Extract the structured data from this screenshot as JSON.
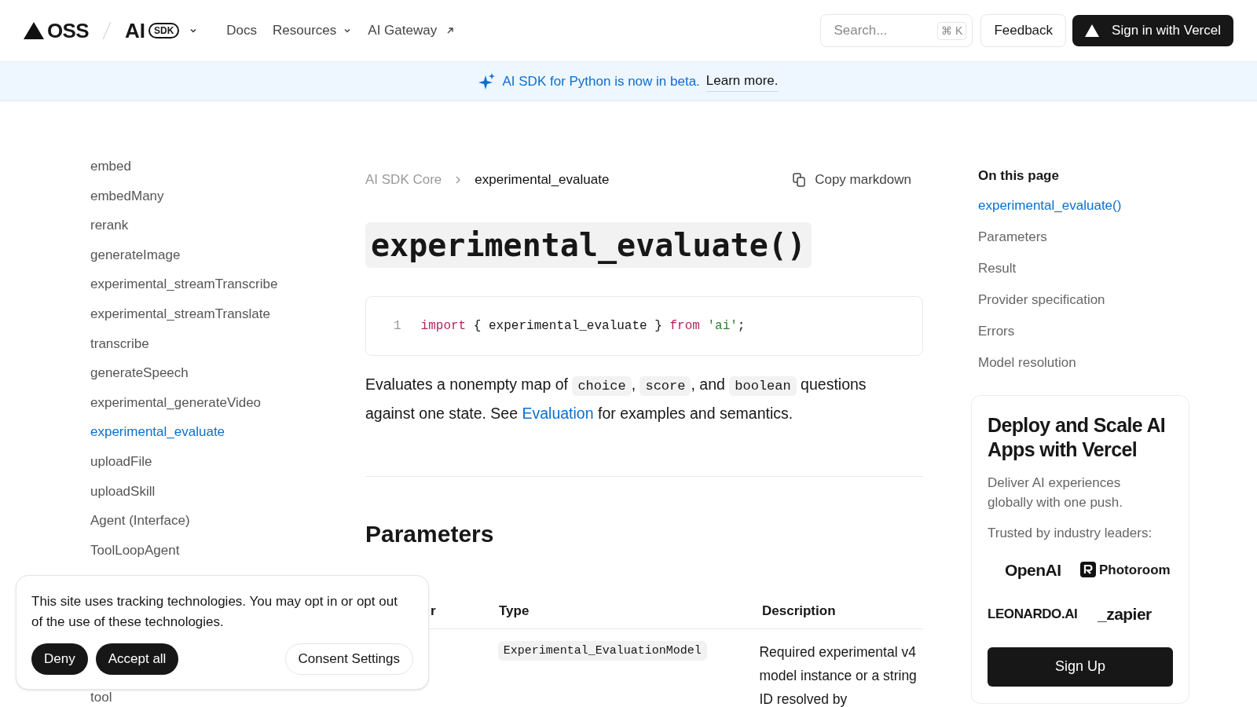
{
  "header": {
    "logo": "OSS",
    "product": "AI",
    "product_badge": "SDK",
    "nav": [
      {
        "label": "Docs",
        "kind": "link"
      },
      {
        "label": "Resources",
        "kind": "dropdown"
      },
      {
        "label": "AI Gateway",
        "kind": "external"
      }
    ],
    "search": {
      "placeholder": "Search...",
      "shortcut": "⌘ K"
    },
    "feedback": "Feedback",
    "sign_in": "Sign in with Vercel"
  },
  "banner": {
    "text": "AI SDK for Python is now in beta.",
    "link": "Learn more."
  },
  "sidebar": {
    "items": [
      {
        "label": "embed",
        "selected": false
      },
      {
        "label": "embedMany",
        "selected": false
      },
      {
        "label": "rerank",
        "selected": false
      },
      {
        "label": "generateImage",
        "selected": false
      },
      {
        "label": "experimental_streamTranscribe",
        "selected": false
      },
      {
        "label": "experimental_streamTranslate",
        "selected": false
      },
      {
        "label": "transcribe",
        "selected": false
      },
      {
        "label": "generateSpeech",
        "selected": false
      },
      {
        "label": "experimental_generateVideo",
        "selected": false
      },
      {
        "label": "experimental_evaluate",
        "selected": true
      },
      {
        "label": "uploadFile",
        "selected": false
      },
      {
        "label": "uploadSkill",
        "selected": false
      },
      {
        "label": "Agent (Interface)",
        "selected": false
      },
      {
        "label": "ToolLoopAgent",
        "selected": false
      }
    ],
    "bottom_item": {
      "label": "tool",
      "selected": false
    }
  },
  "breadcrumb": [
    "AI SDK Core",
    "experimental_evaluate"
  ],
  "copy_button": "Copy markdown",
  "title": "experimental_evaluate()",
  "code": {
    "line_number": "1",
    "tokens": [
      {
        "text": "import",
        "kind": "keyword"
      },
      {
        "text": "{ experimental_evaluate }",
        "kind": "plain"
      },
      {
        "text": "from",
        "kind": "keyword"
      },
      {
        "text": "'ai'",
        "kind": "string"
      },
      {
        "text": ";",
        "kind": "punctuation"
      }
    ]
  },
  "description": [
    {
      "text": "Evaluates a nonempty map of ",
      "kind": "text"
    },
    {
      "text": "choice",
      "kind": "code"
    },
    {
      "text": ", ",
      "kind": "text"
    },
    {
      "text": "score",
      "kind": "code"
    },
    {
      "text": ", and ",
      "kind": "text"
    },
    {
      "text": "boolean",
      "kind": "code"
    },
    {
      "text": " questions against one state. See ",
      "kind": "text"
    },
    {
      "text": "Evaluation",
      "kind": "link"
    },
    {
      "text": " for examples and semantics.",
      "kind": "text"
    }
  ],
  "parameters": {
    "heading": "Parameters",
    "columns": [
      "r",
      "Type",
      "Description"
    ],
    "rows": [
      {
        "type": "Experimental_EvaluationModel",
        "description": "Required experimental v4 model instance or a string ID resolved by"
      }
    ]
  },
  "toc": {
    "title": "On this page",
    "items": [
      {
        "label": "experimental_evaluate()",
        "selected": true
      },
      {
        "label": "Parameters",
        "selected": false
      },
      {
        "label": "Result",
        "selected": false
      },
      {
        "label": "Provider specification",
        "selected": false
      },
      {
        "label": "Errors",
        "selected": false
      },
      {
        "label": "Model resolution",
        "selected": false
      }
    ]
  },
  "promo": {
    "title": "Deploy and Scale AI Apps with Vercel",
    "text": "Deliver AI experiences globally with one push.",
    "trusted": "Trusted by industry leaders:",
    "logos": [
      {
        "text": "OpenAI",
        "kind": "plain"
      },
      {
        "text": "Photoroom",
        "kind": "badge"
      },
      {
        "text": "LEONARDO.AI",
        "kind": "caps"
      },
      {
        "text": "_zapier",
        "kind": "plain"
      }
    ],
    "button": "Sign Up"
  },
  "cookie": {
    "text": "This site uses tracking technologies. You may opt in or opt out of the use of these technologies.",
    "buttons": [
      {
        "label": "Deny",
        "kind": "primary"
      },
      {
        "label": "Accept all",
        "kind": "primary"
      },
      {
        "label": "Consent Settings",
        "kind": "outline"
      }
    ]
  }
}
